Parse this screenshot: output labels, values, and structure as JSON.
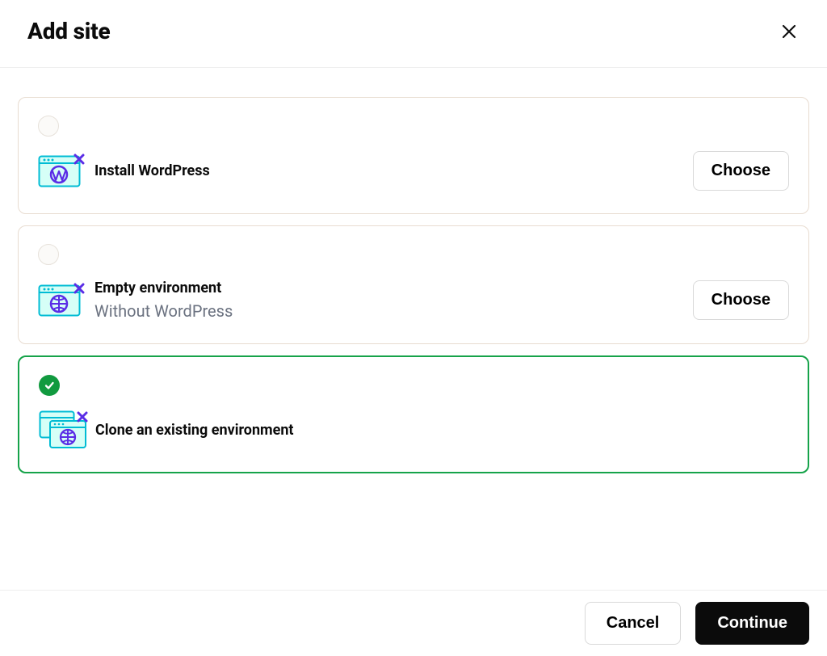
{
  "header": {
    "title": "Add site"
  },
  "options": [
    {
      "title": "Install WordPress",
      "subtitle": "",
      "choose_label": "Choose",
      "selected": false,
      "show_choose": true
    },
    {
      "title": "Empty environment",
      "subtitle": "Without WordPress",
      "choose_label": "Choose",
      "selected": false,
      "show_choose": true
    },
    {
      "title": "Clone an existing environment",
      "subtitle": "",
      "choose_label": "",
      "selected": true,
      "show_choose": false
    }
  ],
  "footer": {
    "cancel": "Cancel",
    "continue": "Continue"
  }
}
